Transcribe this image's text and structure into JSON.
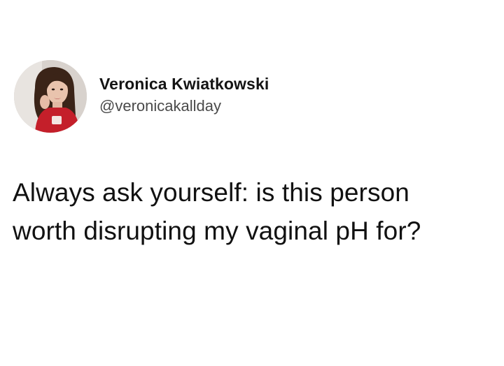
{
  "tweet": {
    "author": {
      "display_name": "Veronica Kwiatkowski",
      "handle": "@veronicakallday",
      "avatar_icon": "profile-photo"
    },
    "text_line_1": "Always ask yourself: is this person",
    "text_line_2": "worth disrupting my vaginal pH for?"
  }
}
